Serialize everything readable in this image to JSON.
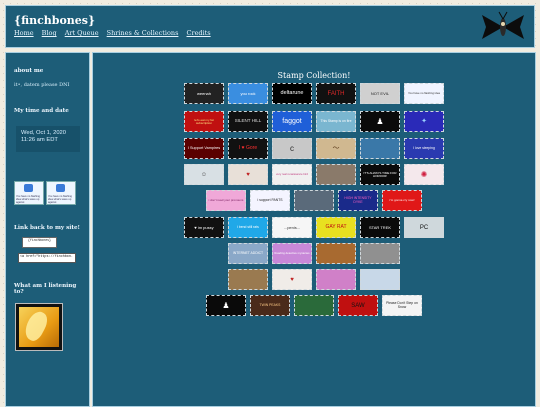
{
  "site": {
    "title": "{finchbones}",
    "nav": [
      "Home",
      "Blog",
      "Art Queue",
      "Shrines & Collections",
      "Credits"
    ]
  },
  "sidebar": {
    "about_heading": "about me",
    "about_text": "it•, datem please DNI",
    "time_heading": "My time and date",
    "time_line1": "Wed, Oct 1, 2020",
    "time_line2": "11:26 am EDT",
    "buttons": [
      "You have no flashing idea what's wave up against",
      "You have no flashing idea what's wave up against"
    ],
    "link_heading": "Link back to my site!",
    "link_button": "{finchbones}",
    "link_code": "<a href=\"https://finchbon.",
    "music_heading": "What am I listening to?"
  },
  "main": {
    "title": "Stamp Collection!",
    "rows": [
      [
        {
          "text": "weenah",
          "bg": "#222222",
          "fg": "#ffffff",
          "fs": 4
        },
        {
          "text": "you rock",
          "bg": "#3a8ee0",
          "fg": "#ffffff",
          "fs": 4
        },
        {
          "text": "deltarune",
          "bg": "#000000",
          "fg": "#ffffff",
          "fs": 5.5
        },
        {
          "text": "FAITH",
          "bg": "#111111",
          "fg": "#e02828",
          "fs": 6
        },
        {
          "text": "NOT EVIL",
          "bg": "#d0d0d0",
          "fg": "#222222",
          "fs": 4
        },
        {
          "text": "You have no flashing idea",
          "bg": "#f0f4ff",
          "fg": "#333333",
          "fs": 2.8
        }
      ],
      [
        {
          "text": "let's eat my fat subscription",
          "bg": "#c01010",
          "fg": "#ffe680",
          "fs": 3
        },
        {
          "text": "SILENT HILL",
          "bg": "#111111",
          "fg": "#dddddd",
          "fs": 4.5
        },
        {
          "text": "faggot",
          "bg": "#1f5fd8",
          "fg": "#ffffff",
          "fs": 7
        },
        {
          "text": "This Stamp is on fire",
          "bg": "#7ab6d0",
          "fg": "#ffffff",
          "fs": 3.4
        },
        {
          "text": "♟",
          "bg": "#0a0a0a",
          "fg": "#ffffff",
          "fs": 8
        },
        {
          "text": "✦",
          "bg": "#2a2ab8",
          "fg": "#9ad0ff",
          "fs": 7
        }
      ],
      [
        {
          "text": "I Support Vampires",
          "bg": "#5a0000",
          "fg": "#ffffff",
          "fs": 3.8
        },
        {
          "text": "I ♥ Gore",
          "bg": "#111111",
          "fg": "#ff3030",
          "fs": 5
        },
        {
          "text": "c",
          "bg": "#c8c8c8",
          "fg": "#2a2a2a",
          "fs": 8
        },
        {
          "text": "〜",
          "bg": "#d0b890",
          "fg": "#5a3a1a",
          "fs": 7
        },
        {
          "text": "",
          "bg": "#3a78a8",
          "fg": "#ffffff",
          "fs": 4
        },
        {
          "text": "I love sleeping",
          "bg": "#2a3ab0",
          "fg": "#ffffff",
          "fs": 3.4
        }
      ],
      [
        {
          "text": "☺",
          "bg": "#d8e0e4",
          "fg": "#444444",
          "fs": 6
        },
        {
          "text": "♥",
          "bg": "#e8e0d8",
          "fg": "#c02020",
          "fs": 6
        },
        {
          "text": "very real renaissance bird",
          "bg": "#f0f0f0",
          "fg": "#c04080",
          "fs": 2.8
        },
        {
          "text": "",
          "bg": "#8a7a6a",
          "fg": "#ffffff",
          "fs": 4
        },
        {
          "text": "IT'S ALWAYS TIME FOR HORROR!",
          "bg": "#0a0a0a",
          "fg": "#ffffff",
          "fs": 3
        },
        {
          "text": "✺",
          "bg": "#f4e8ec",
          "fg": "#d02040",
          "fs": 8
        }
      ],
      [
        {
          "text": "i don't read your pronouns",
          "bg": "#f0a8d8",
          "fg": "#7a2060",
          "fs": 3
        },
        {
          "text": "i support PANTS",
          "bg": "#f4f4ff",
          "fg": "#222222",
          "fs": 3.4
        },
        {
          "text": "",
          "bg": "#5a6a7a",
          "fg": "#ffffff",
          "fs": 4
        },
        {
          "text": "HIGH INTENSITY DYKE",
          "bg": "#1a2a8a",
          "fg": "#ff60c0",
          "fs": 3.4
        },
        {
          "text": "i'm gonna cry now!",
          "bg": "#e01818",
          "fg": "#ffffff",
          "fs": 3
        }
      ],
      [
        {
          "text": "♥ im pussy",
          "bg": "#111111",
          "fg": "#ffffff",
          "fs": 4
        },
        {
          "text": "i bend still rats",
          "bg": "#20a8e8",
          "fg": "#ffffff",
          "fs": 3.4
        },
        {
          "text": "...penis...",
          "bg": "#f6f6f6",
          "fg": "#333333",
          "fs": 4
        },
        {
          "text": "GAY RAT",
          "bg": "#e8e020",
          "fg": "#c01010",
          "fs": 5
        },
        {
          "text": "STAR TREK",
          "bg": "#0a0a0a",
          "fg": "#ffffff",
          "fs": 4
        },
        {
          "text": "PC",
          "bg": "#cfd8dc",
          "fg": "#111111",
          "fs": 6
        }
      ],
      [
        {
          "text": "INTERNET ADDICT",
          "bg": "#8aa8c8",
          "fg": "#ffffff",
          "fs": 3.4
        },
        {
          "text": "Reading detective mysteries",
          "bg": "#c888d8",
          "fg": "#ffffff",
          "fs": 2.8
        },
        {
          "text": "",
          "bg": "#a86a30",
          "fg": "#ffffff",
          "fs": 4
        },
        {
          "text": "",
          "bg": "#909090",
          "fg": "#ffffff",
          "fs": 4
        }
      ],
      [
        {
          "text": "",
          "bg": "#9a7a50",
          "fg": "#ffffff",
          "fs": 4
        },
        {
          "text": "♥",
          "bg": "#f0ece8",
          "fg": "#c02020",
          "fs": 6
        },
        {
          "text": "",
          "bg": "#d080c8",
          "fg": "#ffffff",
          "fs": 4
        },
        {
          "text": "",
          "bg": "#c8d8e8",
          "fg": "#ffffff",
          "fs": 4
        }
      ],
      [
        {
          "text": "♟",
          "bg": "#0a0a0a",
          "fg": "#ffffff",
          "fs": 8
        },
        {
          "text": "TWIN PEAKS",
          "bg": "#4a2a1a",
          "fg": "#ffcc88",
          "fs": 3.4
        },
        {
          "text": "",
          "bg": "#2a6a3a",
          "fg": "#ffffff",
          "fs": 4
        },
        {
          "text": "SAW",
          "bg": "#c01010",
          "fg": "#111111",
          "fs": 6
        },
        {
          "text": "Please Don't Step on Snow",
          "bg": "#f4f4f4",
          "fg": "#222222",
          "fs": 3.4
        }
      ]
    ]
  }
}
